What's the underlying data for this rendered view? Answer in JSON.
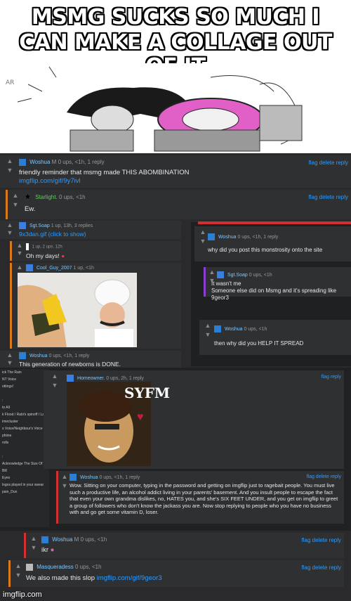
{
  "meme": {
    "title_line1": "MSMG SUCKS SO MUCH I",
    "title_line2": "CAN MAKE A COLLAGE OUT OF IT",
    "watermark": "imgflip.com"
  },
  "colors": {
    "panel": "#2a2a2c",
    "link": "#2e9cff",
    "username": "#7cc8ff",
    "orange_bar": "#d87a1a",
    "purple_bar": "#8a3dd0",
    "red_bar": "#d03030"
  },
  "comments": {
    "c1": {
      "user": "Woshua",
      "badge": "M",
      "meta": "0 ups, <1h, 1 reply",
      "text": "friendly reminder that msmg made THIS ABOMBINATION",
      "link": "imgflip.com/gif/9y7ivl",
      "flags": "flag  delete  reply"
    },
    "c2": {
      "user": "Starlight.",
      "meta": "0 ups, <1h",
      "text": "Ew.",
      "flags": "flag  delete  reply"
    },
    "c3": {
      "user": "Sgt.Soap",
      "meta": "1 up, 13h, 3 replies",
      "text": "9x3dan.gif (click to show)"
    },
    "c4": {
      "user": "",
      "meta": "1 up, 2 ups, 12h",
      "text": "Oh my days!"
    },
    "c5": {
      "user": "Cool_Guy_2007",
      "meta": "1 up, <1h"
    },
    "c6": {
      "user": "Woshua",
      "meta": "0 ups, <1h, 1 reply",
      "text": "This generation of newborns is DONE."
    },
    "r1": {
      "user": "Woshua",
      "meta": "0 ups, <1h, 1 reply",
      "text": "why did you post this monstrosity onto the site"
    },
    "r2": {
      "user": "Sgt.Soap",
      "meta": "0 ups, <1h",
      "text1": "It wasn't me",
      "text2": "Someone else did on Msmg and it's spreading like 9geor3"
    },
    "r3": {
      "user": "Woshua",
      "meta": "0 ups, <1h",
      "text": "then why did you HELP IT SPREAD"
    },
    "h1": {
      "user": "Homeowner.",
      "meta": "0 ups, 2h, 1 reply",
      "flags": "flag  reply",
      "syfm": "SYFM"
    },
    "h2": {
      "user": "Woshua",
      "meta": "0 ups, <1h, 1 reply",
      "flags": "flag  delete  reply",
      "text": "Wow. Sitting on your computer, typing in the password and getting on imgflip just to ragebait people. You must live such a productive life, an alcohol addict living in your parents' basement. And you insult people to escape the fact that even your own grandma dislikes, no, HATES you, and she's SIX FEET UNDER, and you get on imgflip to greet a group of followers who don't know the jackass you are. Now stop replying to people who you have no business with and go get some vitamin D, loser."
    },
    "b1": {
      "user": "Woshua",
      "badge": "M",
      "meta": "0 ups, <1h",
      "text": "ikr",
      "flags": "flag  delete  reply"
    },
    "b2": {
      "user": "Masqueradess",
      "meta": "0 ups, <1h",
      "text": "We also made this slop",
      "link": "imgflip.com/gif/9geor3",
      "flags": "flag  delete  reply"
    }
  },
  "sidebar": [
    "ick The Rain",
    "NT Voice",
    "ottings!",
    "",
    ":",
    "to All",
    "k Flood / Rabi's spinoff / Lanin",
    "imecluster",
    "s Voice/Neighbour's Voice",
    "phiine",
    "rolls",
    "",
    ":",
    "Acknowledge The Size Of Templates",
    "Bill",
    "Eyes",
    "logos played in your swear",
    "pain_Dun"
  ]
}
